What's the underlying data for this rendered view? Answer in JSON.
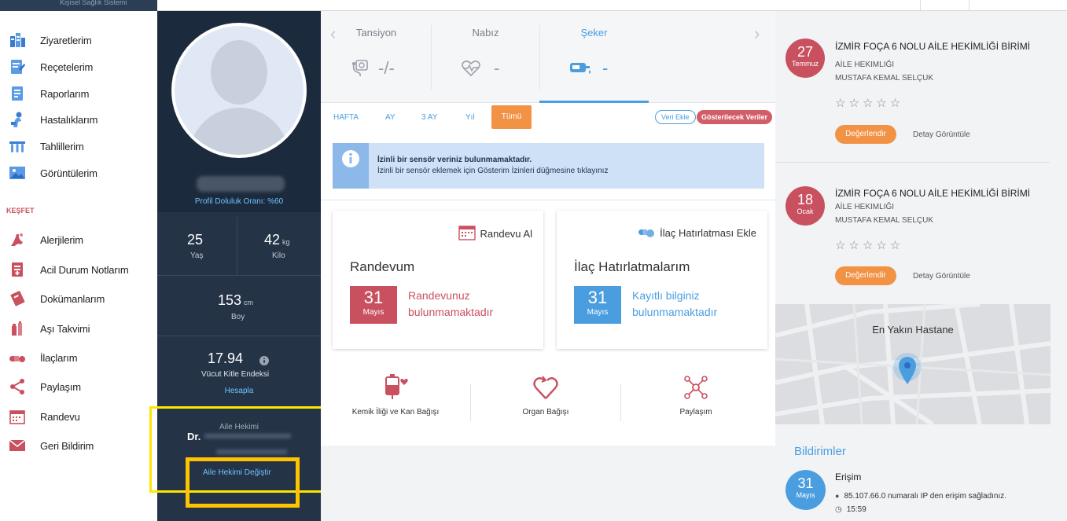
{
  "top_strip_text": "Kişisel Sağlık Sistemi",
  "nav": {
    "items": [
      {
        "label": "Ziyaretlerim",
        "icon": "visits-icon",
        "color": "#3b7bd0"
      },
      {
        "label": "Reçetelerim",
        "icon": "prescription-icon",
        "color": "#3b7bd0"
      },
      {
        "label": "Raporlarım",
        "icon": "report-icon",
        "color": "#3b7bd0"
      },
      {
        "label": "Hastalıklarım",
        "icon": "disease-icon",
        "color": "#3b7bd0"
      },
      {
        "label": "Tahlillerim",
        "icon": "test-tubes-icon",
        "color": "#3b7bd0"
      },
      {
        "label": "Görüntülerim",
        "icon": "images-icon",
        "color": "#3b7bd0"
      }
    ],
    "section_label": "KEŞFET",
    "explore_items": [
      {
        "label": "Alerjilerim",
        "icon": "allergy-icon",
        "color": "#c9515f"
      },
      {
        "label": "Acil Durum Notlarım",
        "icon": "emergency-notes-icon",
        "color": "#c9515f"
      },
      {
        "label": "Dokümanlarım",
        "icon": "documents-icon",
        "color": "#c9515f"
      },
      {
        "label": "Aşı Takvimi",
        "icon": "vaccine-icon",
        "color": "#c9515f"
      },
      {
        "label": "İlaçlarım",
        "icon": "pills-icon",
        "color": "#c9515f"
      },
      {
        "label": "Paylaşım",
        "icon": "share-icon",
        "color": "#c9515f"
      },
      {
        "label": "Randevu",
        "icon": "calendar-icon",
        "color": "#c9515f"
      },
      {
        "label": "Geri Bildirim",
        "icon": "mail-icon",
        "color": "#c9515f"
      }
    ]
  },
  "profile": {
    "fill_rate": "Profil Doluluk Oranı: %60",
    "age_value": "25",
    "age_label": "Yaş",
    "weight_value": "42",
    "weight_unit": "kg",
    "weight_label": "Kilo",
    "height_value": "153",
    "height_unit": "cm",
    "height_label": "Boy",
    "bmi_value": "17.94",
    "bmi_label": "Vücut Kitle Endeksi",
    "calc_link": "Hesapla",
    "doctor_caption": "Aile Hekimi",
    "doctor_prefix": "Dr.",
    "change_doctor": "Aile Hekimi Değiştir"
  },
  "vitals": {
    "items": [
      {
        "title": "Tansiyon",
        "value": "-/-",
        "icon": "blood-pressure-icon"
      },
      {
        "title": "Nabız",
        "value": "-",
        "icon": "heartbeat-icon"
      },
      {
        "title": "Şeker",
        "value": "-",
        "icon": "glucose-meter-icon"
      }
    ],
    "active_index": 2
  },
  "tabs": [
    "HAFTA",
    "AY",
    "3 AY",
    "Yıl",
    "Tümü"
  ],
  "buttons": {
    "add_data": "Veri Ekle",
    "shown_data": "Gösterilecek Veriler"
  },
  "info": {
    "title": "İzinli bir sensör veriniz bulunmamaktadır.",
    "text": "İzinli bir sensör eklemek için Gösterim İzinleri düğmesine tıklayınız"
  },
  "appointment": {
    "action": "Randevu Al",
    "title": "Randevum",
    "day": "31",
    "month": "Mayıs",
    "message_line1": "Randevunuz",
    "message_line2": "bulunmamaktadır"
  },
  "medication": {
    "action": "İlaç Hatırlatması Ekle",
    "title": "İlaç Hatırlatmalarım",
    "day": "31",
    "month": "Mayıs",
    "message_line1": "Kayıtlı bilginiz",
    "message_line2": "bulunmamaktadır"
  },
  "donations": [
    {
      "label": "Kemik İliği ve Kan Bağışı",
      "icon": "blood-donation-icon"
    },
    {
      "label": "Organ Bağışı",
      "icon": "organ-donation-icon"
    },
    {
      "label": "Paylaşım",
      "icon": "network-share-icon"
    }
  ],
  "visits": [
    {
      "day": "27",
      "month": "Temmuz",
      "unit": "İZMİR FOÇA 6 NOLU AİLE HEKİMLİĞİ BİRİMİ",
      "type": "AİLE HEKIMLIĞI",
      "doctor": "MUSTAFA KEMAL SELÇUK",
      "stars": "☆☆☆☆☆",
      "rate_label": "Değerlendir",
      "detail_label": "Detay Görüntüle"
    },
    {
      "day": "18",
      "month": "Ocak",
      "unit": "İZMİR FOÇA 6 NOLU AİLE HEKİMLİĞİ BİRİMİ",
      "type": "AİLE HEKIMLIĞI",
      "doctor": "MUSTAFA KEMAL SELÇUK",
      "stars": "☆☆☆☆☆",
      "rate_label": "Değerlendir",
      "detail_label": "Detay Görüntüle"
    }
  ],
  "map": {
    "title": "En Yakın Hastane"
  },
  "notifications": {
    "heading": "Bildirimler",
    "day": "31",
    "month": "Mayıs",
    "title": "Erişim",
    "text": "85.107.66.0 numaralı IP den erişim sağladınız.",
    "time": "15:59"
  },
  "colors": {
    "accent_blue": "#4a9ee0",
    "accent_red": "#c9515f",
    "accent_orange": "#f29244",
    "panel_dark": "#253347"
  }
}
